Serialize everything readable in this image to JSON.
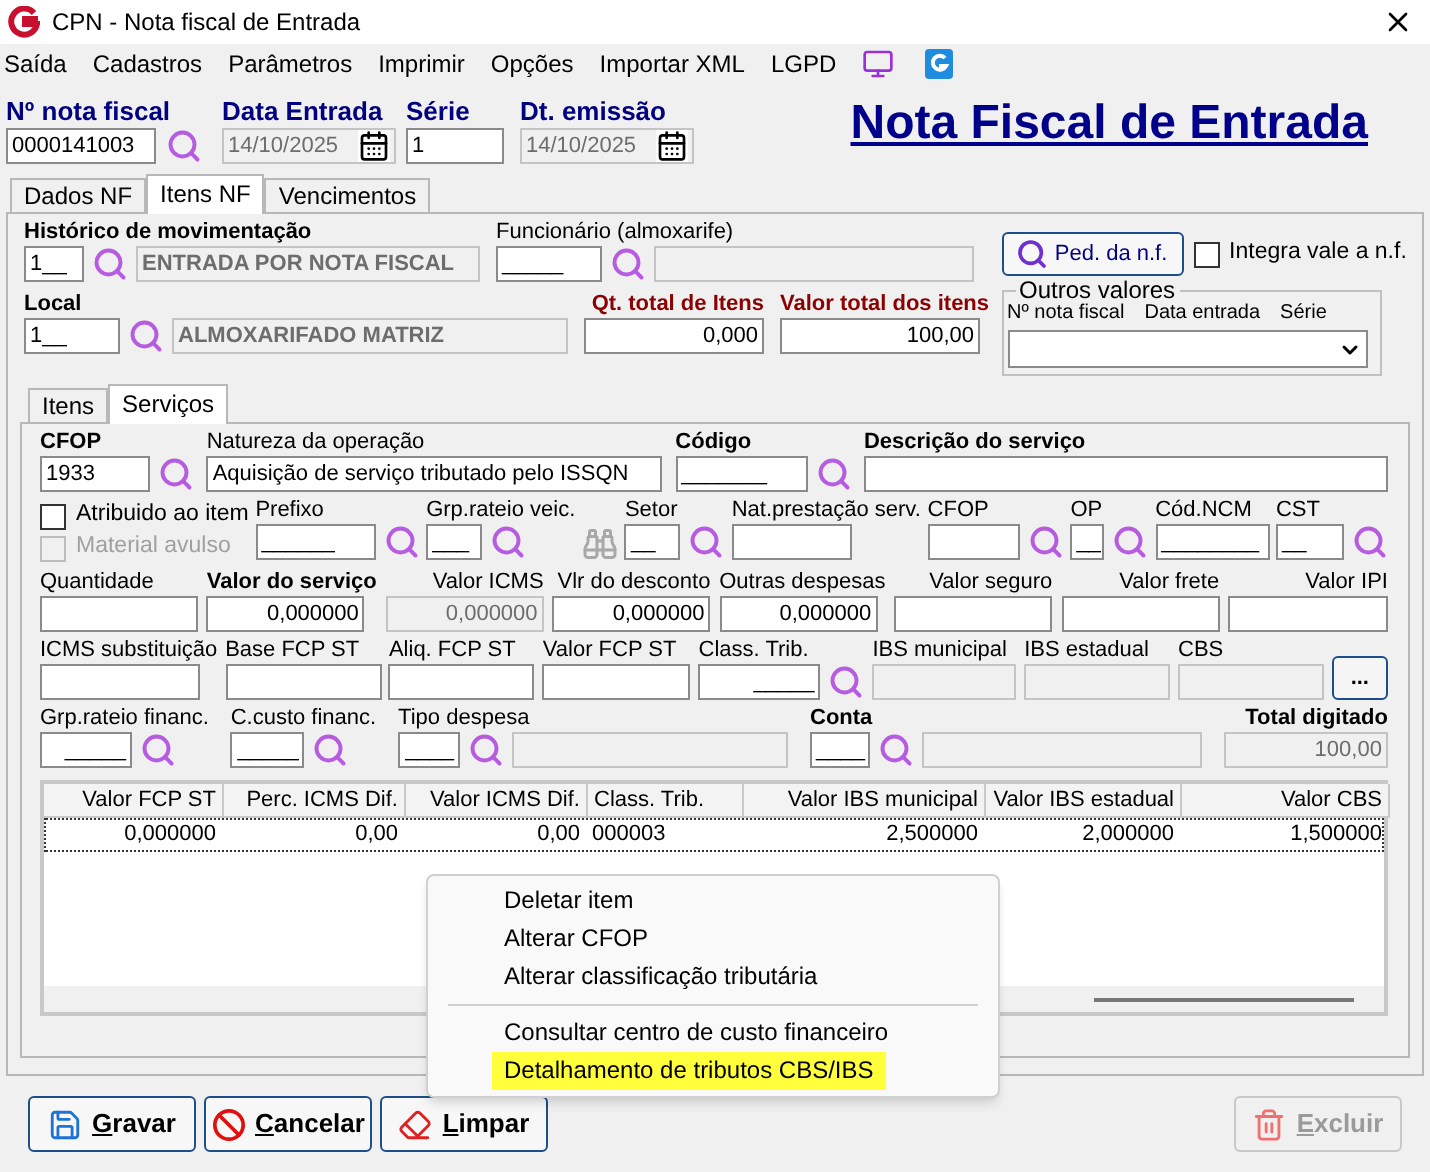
{
  "window": {
    "title": "CPN - Nota fiscal de Entrada"
  },
  "menu": [
    "Saída",
    "Cadastros",
    "Parâmetros",
    "Imprimir",
    "Opções",
    "Importar XML",
    "LGPD"
  ],
  "header": {
    "fields": [
      {
        "label": "Nº nota fiscal",
        "value": "0000141003",
        "kind": "lookup"
      },
      {
        "label": "Data Entrada",
        "value": "14/10/2025",
        "kind": "date"
      },
      {
        "label": "Série",
        "value": "1",
        "kind": "text"
      },
      {
        "label": "Dt. emissão",
        "value": "14/10/2025",
        "kind": "date"
      }
    ],
    "title": "Nota Fiscal de Entrada"
  },
  "tabs": [
    {
      "label": "Dados NF",
      "selected": false
    },
    {
      "label": "Itens NF",
      "selected": true
    },
    {
      "label": "Vencimentos",
      "selected": false
    }
  ],
  "movement": {
    "rows": [
      [
        {
          "label": "Histórico de movimentação",
          "bold": true,
          "warning": false,
          "value": "1__",
          "disabled": false,
          "lookup": true,
          "description": {
            "value": "ENTRADA POR NOTA FISCAL",
            "disabled": true
          }
        },
        {
          "label": "Funcionário (almoxarife)",
          "bold": false,
          "warning": false,
          "value": "_____",
          "disabled": false,
          "lookup": true,
          "description": {
            "disabled": true
          }
        }
      ],
      [
        {
          "label": "Local",
          "bold": true,
          "warning": false,
          "value": "1__",
          "disabled": false,
          "lookup": true,
          "description": {
            "value": "ALMOXARIFADO MATRIZ",
            "disabled": true
          }
        },
        {
          "label": "Qt. total de Itens",
          "bold": true,
          "warning": true,
          "value": "0,000",
          "disabled": false,
          "lookup": false
        },
        {
          "label": "Valor total dos itens",
          "bold": true,
          "warning": true,
          "value": "100,00",
          "disabled": false,
          "lookup": false
        }
      ]
    ],
    "order_button": "Ped. da n.f.",
    "integra": {
      "label": "Integra vale a n.f.",
      "checked": false
    },
    "other_values": {
      "title": "Outros valores",
      "columns": [
        "Nº nota fiscal",
        "Data entrada",
        "Série"
      ]
    }
  },
  "subtabs": [
    {
      "label": "Itens",
      "selected": false
    },
    {
      "label": "Serviços",
      "selected": true
    }
  ],
  "services": {
    "lines": [
      {
        "fields": [
          {
            "kind": "field",
            "label": "CFOP",
            "bold": true,
            "value": "1933",
            "disabled": false,
            "lookup": true
          },
          {
            "kind": "field",
            "label": "Natureza da operação",
            "bold": false,
            "value": "Aquisição de serviço tributado pelo ISSQN",
            "disabled": false,
            "lookup": false
          },
          {
            "kind": "field",
            "label": "Código",
            "bold": true,
            "value": "_______",
            "disabled": false,
            "lookup": true
          },
          {
            "kind": "field",
            "label": "Descrição do serviço",
            "bold": true,
            "disabled": false,
            "lookup": false
          }
        ]
      },
      {
        "fields": [
          {
            "kind": "checkboxes",
            "items": [
              {
                "label": "Atribuido ao item",
                "checked": false,
                "disabled": false
              },
              {
                "label": "Material avulso",
                "checked": false,
                "disabled": true
              }
            ]
          },
          {
            "kind": "field",
            "label": "Prefixo",
            "bold": false,
            "value": "______",
            "disabled": false,
            "lookup": true
          },
          {
            "kind": "field",
            "label": "Grp.rateio veic.",
            "bold": false,
            "value": "___",
            "disabled": false,
            "lookup": true
          },
          {
            "kind": "finder",
            "disabled": true
          },
          {
            "kind": "field",
            "label": "Setor",
            "bold": false,
            "value": "__",
            "disabled": false,
            "lookup": true
          },
          {
            "kind": "field",
            "label": "Nat.prestação serv.",
            "bold": false,
            "disabled": false,
            "lookup": false
          },
          {
            "kind": "field",
            "label": "CFOP",
            "bold": false,
            "disabled": false,
            "lookup": true
          },
          {
            "kind": "field",
            "label": "OP",
            "bold": false,
            "value": "__",
            "disabled": false,
            "lookup": true
          },
          {
            "kind": "field",
            "label": "Cód.NCM",
            "bold": false,
            "value": "________",
            "disabled": false,
            "lookup": false
          },
          {
            "kind": "field",
            "label": "CST",
            "bold": false,
            "value": "__",
            "disabled": false,
            "lookup": true
          }
        ]
      },
      {
        "fields": [
          {
            "kind": "field",
            "label": "Quantidade",
            "bold": false,
            "disabled": false,
            "lookup": false
          },
          {
            "kind": "field",
            "label": "Valor do serviço",
            "bold": true,
            "value": "0,000000",
            "disabled": false,
            "lookup": false
          },
          {
            "kind": "field",
            "label": "Valor ICMS",
            "bold": false,
            "value": "0,000000",
            "disabled": true,
            "lookup": false
          },
          {
            "kind": "field",
            "label": "Vlr do desconto",
            "bold": false,
            "value": "0,000000",
            "disabled": false,
            "lookup": false
          },
          {
            "kind": "field",
            "label": "Outras despesas",
            "bold": false,
            "value": "0,000000",
            "disabled": false,
            "lookup": false
          },
          {
            "kind": "field",
            "label": "Valor seguro",
            "bold": false,
            "disabled": false,
            "lookup": false
          },
          {
            "kind": "field",
            "label": "Valor frete",
            "bold": false,
            "disabled": false,
            "lookup": false
          },
          {
            "kind": "field",
            "label": "Valor IPI",
            "bold": false,
            "disabled": false,
            "lookup": false
          }
        ]
      },
      {
        "fields": [
          {
            "kind": "field",
            "label": "ICMS substituição",
            "bold": false,
            "disabled": false,
            "lookup": false
          },
          {
            "kind": "field",
            "label": "Base FCP ST",
            "bold": false,
            "disabled": false,
            "lookup": false
          },
          {
            "kind": "field",
            "label": "Aliq. FCP ST",
            "bold": false,
            "disabled": false,
            "lookup": false
          },
          {
            "kind": "field",
            "label": "Valor FCP ST",
            "bold": false,
            "disabled": false,
            "lookup": false
          },
          {
            "kind": "field",
            "label": "Class. Trib.",
            "bold": false,
            "value": "_____",
            "disabled": false,
            "lookup": true
          },
          {
            "kind": "field",
            "label": "IBS municipal",
            "bold": false,
            "disabled": true,
            "lookup": false
          },
          {
            "kind": "field",
            "label": "IBS estadual",
            "bold": false,
            "disabled": true,
            "lookup": false
          },
          {
            "kind": "field",
            "label": "CBS",
            "bold": false,
            "disabled": true,
            "lookup": false
          },
          {
            "kind": "more_button",
            "label": "..."
          }
        ]
      },
      {
        "fields": [
          {
            "kind": "field",
            "label": "Grp.rateio financ.",
            "bold": false,
            "value": "_____",
            "disabled": false,
            "lookup": true
          },
          {
            "kind": "field",
            "label": "C.custo financ.",
            "bold": false,
            "value": "_____",
            "disabled": false,
            "lookup": true
          },
          {
            "kind": "field",
            "label": "Tipo despesa",
            "bold": false,
            "value": "____",
            "disabled": false,
            "lookup": true,
            "description": {
              "disabled": true
            }
          },
          {
            "kind": "field",
            "label": "Conta",
            "bold": true,
            "value": "____",
            "disabled": false,
            "lookup": true,
            "description": {
              "disabled": true
            }
          },
          {
            "kind": "field",
            "label": "Total digitado",
            "bold": true,
            "value": "100,00",
            "disabled": true,
            "lookup": false
          }
        ]
      }
    ],
    "table": {
      "columns": [
        "Valor FCP ST",
        "Perc. ICMS Dif.",
        "Valor ICMS Dif.",
        "Class. Trib.",
        "Valor IBS municipal",
        "Valor IBS estadual",
        "Valor CBS"
      ],
      "rows": [
        {
          "selected": true,
          "cells": [
            "0,000000",
            "0,00",
            "0,00",
            "000003",
            "2,500000",
            "2,000000",
            "1,500000"
          ]
        }
      ]
    }
  },
  "context_menu": [
    {
      "label": "Deletar item",
      "selected": false
    },
    {
      "label": "Alterar CFOP",
      "selected": false
    },
    {
      "label": "Alterar classificação tributária",
      "selected": false
    },
    {
      "kind": "separator"
    },
    {
      "label": "Consultar centro de custo financeiro",
      "selected": false
    },
    {
      "label": "Detalhamento de tributos CBS/IBS",
      "selected": true
    }
  ],
  "buttons": [
    {
      "label": "Gravar",
      "kind": "save",
      "disabled": false
    },
    {
      "label": "Cancelar",
      "kind": "cancel",
      "disabled": false
    },
    {
      "label": "Limpar",
      "kind": "clear",
      "disabled": false
    },
    {
      "label": "Excluir",
      "kind": "delete",
      "disabled": true
    }
  ]
}
